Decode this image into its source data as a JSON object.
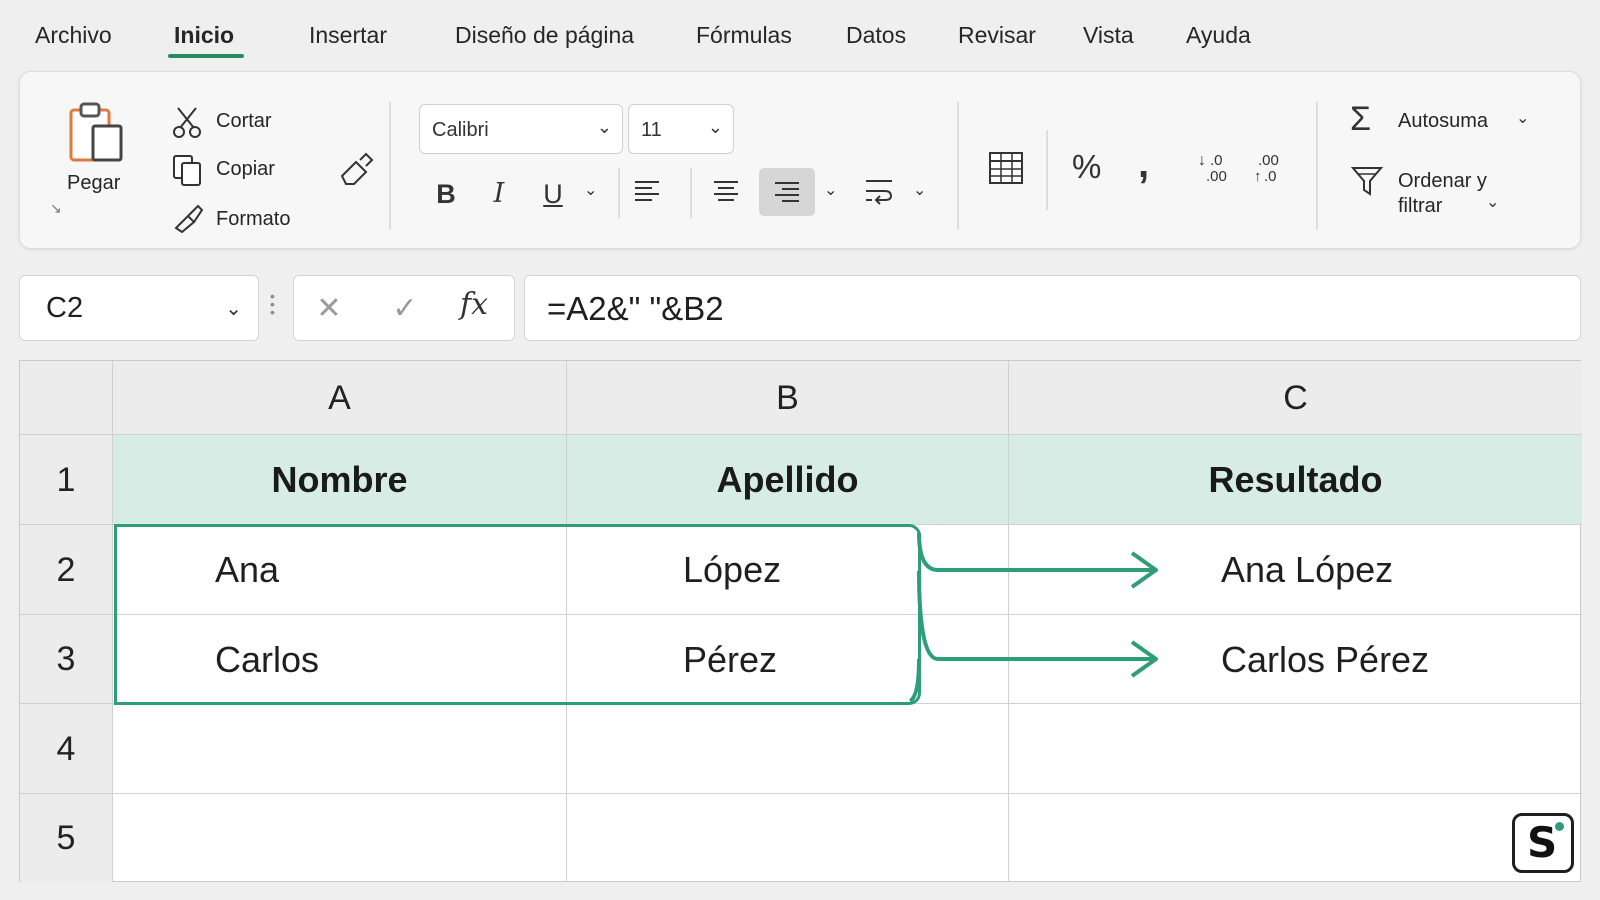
{
  "menu": {
    "tabs": [
      {
        "label": "Archivo"
      },
      {
        "label": "Inicio"
      },
      {
        "label": "Insertar"
      },
      {
        "label": "Diseño de página"
      },
      {
        "label": "Fórmulas"
      },
      {
        "label": "Datos"
      },
      {
        "label": "Revisar"
      },
      {
        "label": "Vista"
      },
      {
        "label": "Ayuda"
      }
    ],
    "active": "Inicio"
  },
  "ribbon": {
    "clipboard": {
      "paste_label": "Pegar",
      "cut_label": "Cortar",
      "copy_label": "Copiar",
      "format_label": "Formato"
    },
    "font": {
      "name": "Calibri",
      "size": "11",
      "bold": "B",
      "italic": "I",
      "underline": "U"
    },
    "number": {
      "percent": "%",
      "comma": ",",
      "increase_decimal": ".0",
      "decrease_decimal": ".00"
    },
    "editing": {
      "autosum_label": "Autosuma",
      "sort_label_line1": "Ordenar y",
      "sort_label_line2": "filtrar"
    }
  },
  "formula_bar": {
    "name_box": "C2",
    "fx": "fx",
    "formula": "=A2&\" \"&B2"
  },
  "sheet": {
    "columns": [
      "A",
      "B",
      "C"
    ],
    "rows": [
      "1",
      "2",
      "3",
      "4",
      "5"
    ],
    "headers": {
      "a": "Nombre",
      "b": "Apellido",
      "c": "Resultado"
    },
    "data": [
      {
        "a": "Ana",
        "b": "López",
        "c": "Ana López"
      },
      {
        "a": "Carlos",
        "b": "Pérez",
        "c": "Carlos Pérez"
      }
    ]
  },
  "colors": {
    "accent": "#2e9e78",
    "header_fill": "#d7ece4",
    "tab_underline": "#2b8a5f"
  },
  "logo": {
    "letter": "S"
  }
}
